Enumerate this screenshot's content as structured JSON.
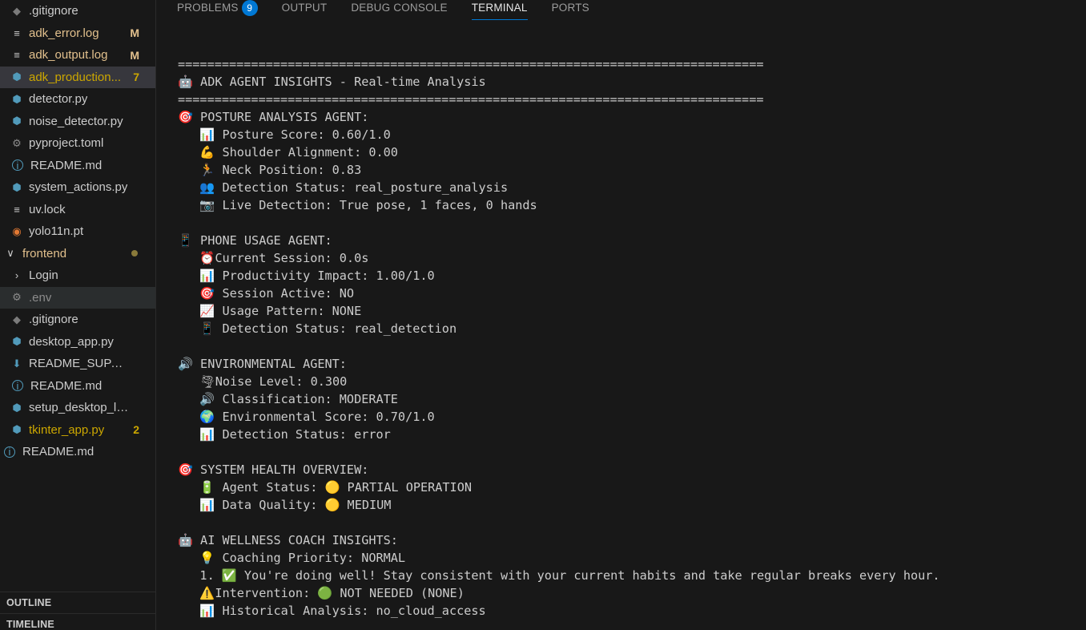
{
  "explorer": {
    "items": [
      {
        "icon": "git-icon",
        "glyph": "◆",
        "label": ".gitignore",
        "badge": "",
        "state": "normal",
        "indent": 1
      },
      {
        "icon": "log-file-icon",
        "glyph": "≡",
        "label": "adk_error.log",
        "badge": "M",
        "state": "mod",
        "indent": 1
      },
      {
        "icon": "log-file-icon",
        "glyph": "≡",
        "label": "adk_output.log",
        "badge": "M",
        "state": "mod",
        "indent": 1
      },
      {
        "icon": "python-icon",
        "glyph": "⬢",
        "label": "adk_production...",
        "badge": "7",
        "state": "warn-selected",
        "indent": 1
      },
      {
        "icon": "python-icon",
        "glyph": "⬢",
        "label": "detector.py",
        "badge": "",
        "state": "normal",
        "indent": 1
      },
      {
        "icon": "python-icon",
        "glyph": "⬢",
        "label": "noise_detector.py",
        "badge": "",
        "state": "normal",
        "indent": 1
      },
      {
        "icon": "gear-icon",
        "glyph": "⚙",
        "label": "pyproject.toml",
        "badge": "",
        "state": "normal",
        "indent": 1
      },
      {
        "icon": "info-icon",
        "glyph": "i",
        "label": "README.md",
        "badge": "",
        "state": "normal",
        "indent": 1
      },
      {
        "icon": "python-icon",
        "glyph": "⬢",
        "label": "system_actions.py",
        "badge": "",
        "state": "normal",
        "indent": 1
      },
      {
        "icon": "lock-file-icon",
        "glyph": "≡",
        "label": "uv.lock",
        "badge": "",
        "state": "normal",
        "indent": 1
      },
      {
        "icon": "rss-icon",
        "glyph": "◉",
        "label": "yolo11n.pt",
        "badge": "",
        "state": "normal",
        "indent": 1
      },
      {
        "icon": "chevron-down-icon",
        "glyph": "∨",
        "label": "frontend",
        "badge": "",
        "state": "folder-open",
        "indent": 0
      },
      {
        "icon": "chevron-right-icon",
        "glyph": "›",
        "label": "Login",
        "badge": "",
        "state": "folder-closed",
        "indent": 1
      },
      {
        "icon": "gear-icon",
        "glyph": "⚙",
        "label": ".env",
        "badge": "",
        "state": "dim-hover",
        "indent": 1
      },
      {
        "icon": "git-icon",
        "glyph": "◆",
        "label": ".gitignore",
        "badge": "",
        "state": "normal",
        "indent": 1
      },
      {
        "icon": "python-icon",
        "glyph": "⬢",
        "label": "desktop_app.py",
        "badge": "",
        "state": "normal",
        "indent": 1
      },
      {
        "icon": "download-icon",
        "glyph": "⬇",
        "label": "README_SUPABASE...",
        "badge": "",
        "state": "normal",
        "indent": 1
      },
      {
        "icon": "info-icon",
        "glyph": "i",
        "label": "README.md",
        "badge": "",
        "state": "normal",
        "indent": 1
      },
      {
        "icon": "python-icon",
        "glyph": "⬢",
        "label": "setup_desktop_laun...",
        "badge": "",
        "state": "normal",
        "indent": 1
      },
      {
        "icon": "python-icon",
        "glyph": "⬢",
        "label": "tkinter_app.py",
        "badge": "2",
        "state": "warn",
        "indent": 1
      },
      {
        "icon": "info-icon",
        "glyph": "i",
        "label": "README.md",
        "badge": "",
        "state": "normal",
        "indent": 0
      }
    ],
    "outline_label": "OUTLINE",
    "timeline_label": "TIMELINE"
  },
  "panel": {
    "tabs": [
      {
        "label": "PROBLEMS",
        "count": "9",
        "active": false
      },
      {
        "label": "OUTPUT",
        "count": "",
        "active": false
      },
      {
        "label": "DEBUG CONSOLE",
        "count": "",
        "active": false
      },
      {
        "label": "TERMINAL",
        "count": "",
        "active": true
      },
      {
        "label": "PORTS",
        "count": "",
        "active": false
      }
    ]
  },
  "terminal": {
    "lines": [
      "================================================================================",
      "🤖 ADK AGENT INSIGHTS - Real-time Analysis",
      "================================================================================",
      "🎯 POSTURE ANALYSIS AGENT:",
      "   📊 Posture Score: 0.60/1.0",
      "   💪 Shoulder Alignment: 0.00",
      "   🏃 Neck Position: 0.83",
      "   👥 Detection Status: real_posture_analysis",
      "   📷 Live Detection: True pose, 1 faces, 0 hands",
      "",
      "📱 PHONE USAGE AGENT:",
      "   ⏰Current Session: 0.0s",
      "   📊 Productivity Impact: 1.00/1.0",
      "   🎯 Session Active: NO",
      "   📈 Usage Pattern: NONE",
      "   📱 Detection Status: real_detection",
      "",
      "🔊 ENVIRONMENTAL AGENT:",
      "   🌪Noise Level: 0.300",
      "   🔊 Classification: MODERATE",
      "   🌍 Environmental Score: 0.70/1.0",
      "   📊 Detection Status: error",
      "",
      "🎯 SYSTEM HEALTH OVERVIEW:",
      "   🔋 Agent Status: 🟡 PARTIAL OPERATION",
      "   📊 Data Quality: 🟡 MEDIUM",
      "",
      "🤖 AI WELLNESS COACH INSIGHTS:",
      "   💡 Coaching Priority: NORMAL",
      "   1. ✅ You're doing well! Stay consistent with your current habits and take regular breaks every hour.",
      "   ⚠️Intervention: 🟢 NOT NEEDED (NONE)",
      "   📊 Historical Analysis: no_cloud_access"
    ]
  }
}
